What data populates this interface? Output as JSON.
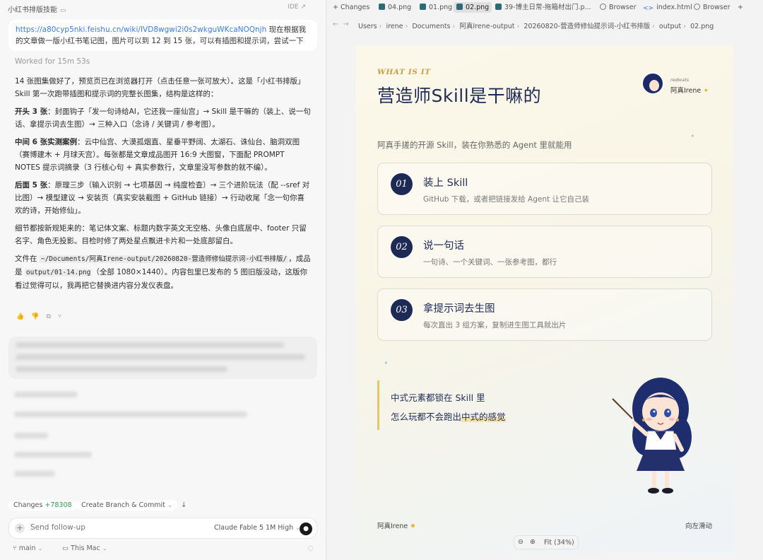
{
  "left_panel": {
    "title": "小红书排版技能",
    "ide_link": "IDE ↗",
    "prompt": {
      "link": "https://a80cyp5nki.feishu.cn/wiki/IVD8wgwi2i0s2wkguWKcaNOQnjh",
      "text": " 现在根据我的文章做一版小红书笔记图，图片可以到 12 到 15 张，可以有插图和提示词，尝试一下"
    },
    "worked_label": "Worked for 15m 53s",
    "answer": {
      "p1": "14 张图集做好了，预览页已在浏览器打开（点击任意一张可放大）。这是「小红书排版」Skill 第一次跑带插图和提示词的完整长图集，结构是这样的：",
      "p2_bold": "开头 3 张",
      "p2": "：封面钩子「发一句诗给AI，它还我一座仙宫」→ Skill 是干嘛的（装上、说一句话、拿提示词去生图）→ 三种入口（念诗 / 关键词 / 参考图）。",
      "p3_bold": "中间 6 张实测案例",
      "p3": "：云中仙宫、大漠孤烟直、星垂平野阔、太湖石、诛仙台、脑洞双图（赛博建木 + 月球天宫）。每张都是文章成品图开 16:9 大图窗，下面配 PROMPT NOTES 提示词摘录（3 行核心句 + 真实参数行，文章里没写参数的就不编）。",
      "p4_bold": "后面 5 张",
      "p4": "：原理三步（输入识别 → 七项基因 → 纯度检查）→ 三个进阶玩法（配 --sref 对比图）→ 模型建议 → 安装页（真实安装截图 + GitHub 链接）→ 行动收尾「念一句你喜欢的诗，开始修仙」。",
      "p5": "细节都按新规矩来的：笔记体文案、标题内数字英文无空格、头像白底居中、footer 只留名字、角色无投影。目检时修了两处星点飘进卡片和一处底部留白。",
      "p6_a": "文件在 ",
      "p6_code1": "~/Documents/阿真Irene-output/20260820-营造师修仙提示词-小红书排版/",
      "p6_b": "，成品是 ",
      "p6_code2": "output/01-14.png",
      "p6_c": "（全部 1080×1440）。内容包里已发布的 5 图旧版没动，这版你看过觉得可以，我再把它替换进内容分发仪表盘。"
    },
    "actions": [
      "👍",
      "👎",
      "⧉",
      "⑂"
    ],
    "changes_label": "Changes",
    "changes_count": "+78308",
    "create_branch": "Create Branch & Commit",
    "composer_placeholder": "Send follow-up",
    "model": "Claude Fable 5 1M High",
    "branch": "main",
    "environment": "This Mac"
  },
  "tabs": [
    {
      "label": "Changes",
      "icon": "plus-icon"
    },
    {
      "label": "04.png",
      "icon": "image-icon"
    },
    {
      "label": "01.png",
      "icon": "image-icon"
    },
    {
      "label": "02.png",
      "icon": "image-icon",
      "active": true
    },
    {
      "label": "39-博主日常-拖箱材出门.p...",
      "icon": "image-icon"
    },
    {
      "label": "Browser",
      "icon": "globe-icon"
    },
    {
      "label": "index.html",
      "icon": "code-icon"
    },
    {
      "label": "Browser",
      "icon": "globe-icon"
    }
  ],
  "breadcrumb": [
    "Users",
    "irene",
    "Documents",
    "阿真Irene-output",
    "20260820-营造师修仙提示词-小红书排版",
    "output",
    "02.png"
  ],
  "poster": {
    "eyebrow": "WHAT IS IT",
    "title": "营造师Skill是干嘛的",
    "avatar_handle": "redwats",
    "avatar_name": "阿真Irene",
    "subtitle": "阿真手搓的开源 Skill，装在你熟悉的 Agent 里就能用",
    "steps": [
      {
        "num": "01",
        "title": "装上 Skill",
        "desc": "GitHub 下载，或者把链接发给 Agent 让它自己装"
      },
      {
        "num": "02",
        "title": "说一句话",
        "desc": "一句诗、一个关键词、一张参考图，都行"
      },
      {
        "num": "03",
        "title": "拿提示词去生图",
        "desc": "每次直出 3 组方案，复制进生图工具就出片"
      }
    ],
    "quote_line1": "中式元素都锁在 Skill 里",
    "quote_line2_a": "怎么玩都不会跑出",
    "quote_line2_hl": "中式的感觉",
    "footer_name": "阿真Irene",
    "footer_hint": "向左滑动"
  },
  "zoom": {
    "out": "⊖",
    "in": "⊕",
    "label": "Fit (34%)"
  }
}
